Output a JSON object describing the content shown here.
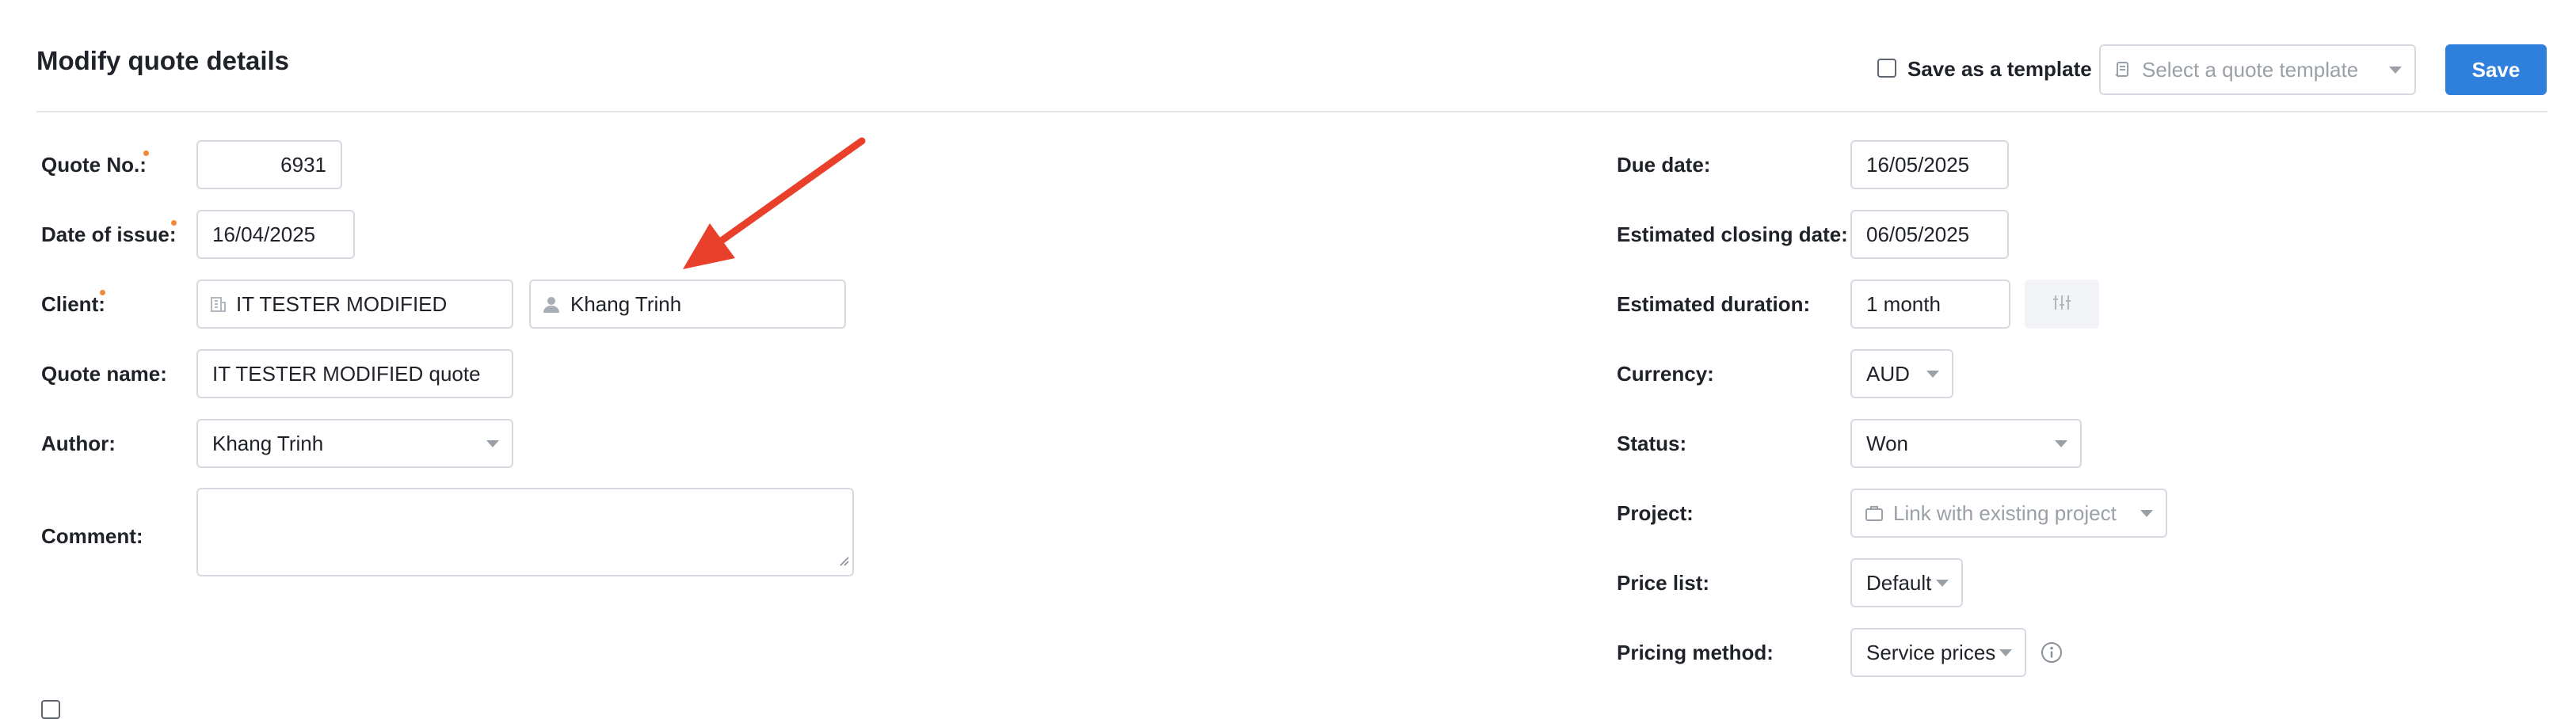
{
  "page": {
    "title": "Modify quote details"
  },
  "toolbar": {
    "save_as_template_label": "Save as a template",
    "template_select_placeholder": "Select a quote template",
    "save_label": "Save"
  },
  "left": {
    "quote_no": {
      "label": "Quote No.:",
      "value": "6931"
    },
    "date_of_issue": {
      "label": "Date of issue:",
      "value": "16/04/2025"
    },
    "client": {
      "label": "Client:",
      "company": "IT TESTER MODIFIED",
      "contact": "Khang Trinh"
    },
    "quote_name": {
      "label": "Quote name:",
      "value": "IT TESTER MODIFIED quote"
    },
    "author": {
      "label": "Author:",
      "value": "Khang Trinh"
    },
    "comment": {
      "label": "Comment:",
      "value": ""
    }
  },
  "right": {
    "due_date": {
      "label": "Due date:",
      "value": "16/05/2025"
    },
    "estimated_closing_date": {
      "label": "Estimated closing date:",
      "value": "06/05/2025"
    },
    "estimated_duration": {
      "label": "Estimated duration:",
      "value": "1 month"
    },
    "currency": {
      "label": "Currency:",
      "value": "AUD"
    },
    "status": {
      "label": "Status:",
      "value": "Won"
    },
    "project": {
      "label": "Project:",
      "placeholder": "Link with existing project"
    },
    "price_list": {
      "label": "Price list:",
      "value": "Default"
    },
    "pricing_method": {
      "label": "Pricing method:",
      "value": "Service prices"
    }
  },
  "colors": {
    "accent": "#2f7fdc",
    "required_dot": "#f0883a",
    "annotation_arrow": "#e8402a"
  },
  "icons": [
    "template-icon",
    "building-icon",
    "person-icon",
    "sliders-icon",
    "briefcase-icon",
    "info-icon",
    "resize-handle-icon",
    "annotation-arrow"
  ]
}
